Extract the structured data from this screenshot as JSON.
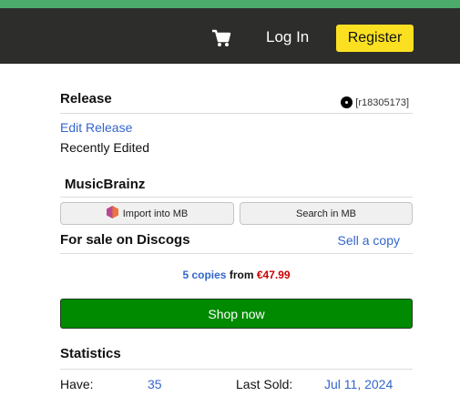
{
  "colors": {
    "accent_green": "#4aab6a",
    "nav_bg": "#2d2d2b",
    "register_bg": "#fbe022",
    "link": "#3366cc",
    "price": "#cc0000",
    "shop_bg": "#008a00"
  },
  "header": {
    "cart_icon": "shopping-cart-icon",
    "login_label": "Log In",
    "register_label": "Register"
  },
  "release": {
    "title": "Release",
    "id_icon": "vinyl-record-icon",
    "id": "[r18305173]",
    "edit_label": "Edit Release",
    "status": "Recently Edited"
  },
  "musicbrainz": {
    "title": "MusicBrainz",
    "import_icon": "musicbrainz-logo-icon",
    "import_label": "Import into MB",
    "search_label": "Search in MB"
  },
  "sale": {
    "title": "For sale on Discogs",
    "sell_label": "Sell a copy",
    "copies": "5 copies",
    "from_word": "from",
    "price": "€47.99",
    "shop_label": "Shop now"
  },
  "stats": {
    "title": "Statistics",
    "have_label": "Have:",
    "have_value": "35",
    "last_sold_label": "Last Sold:",
    "last_sold_value": "Jul 11, 2024"
  }
}
